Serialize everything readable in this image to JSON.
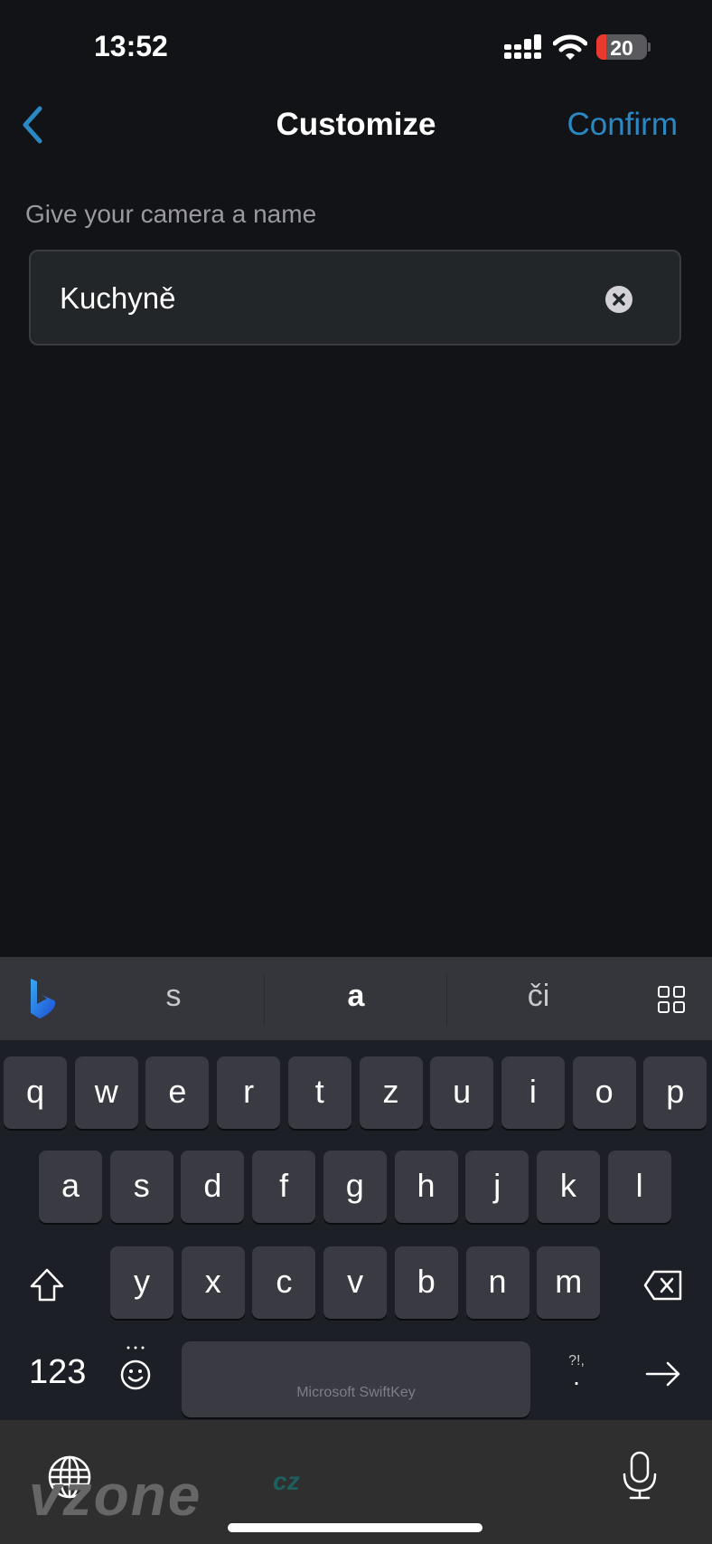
{
  "status_bar": {
    "time": "13:52",
    "battery_level": "20",
    "battery_percent": 20,
    "battery_color": "#e8392f"
  },
  "nav": {
    "back_icon": "chevron-left-icon",
    "title": "Customize",
    "confirm_label": "Confirm",
    "accent_color": "#2a88c3"
  },
  "form": {
    "label": "Give your camera a name",
    "name_value": "Kuchyně",
    "clear_icon": "clear-x-icon"
  },
  "keyboard": {
    "brand": "Microsoft SwiftKey",
    "suggestions": [
      "s",
      "a",
      "či"
    ],
    "rows": [
      [
        "q",
        "w",
        "e",
        "r",
        "t",
        "z",
        "u",
        "i",
        "o",
        "p"
      ],
      [
        "a",
        "s",
        "d",
        "f",
        "g",
        "h",
        "j",
        "k",
        "l"
      ],
      [
        "y",
        "x",
        "c",
        "v",
        "b",
        "n",
        "m"
      ]
    ],
    "numbers_label": "123",
    "punct_top": "?!,",
    "punct_main": "."
  },
  "watermark": {
    "text": "vzone",
    "suffix": "cz"
  }
}
